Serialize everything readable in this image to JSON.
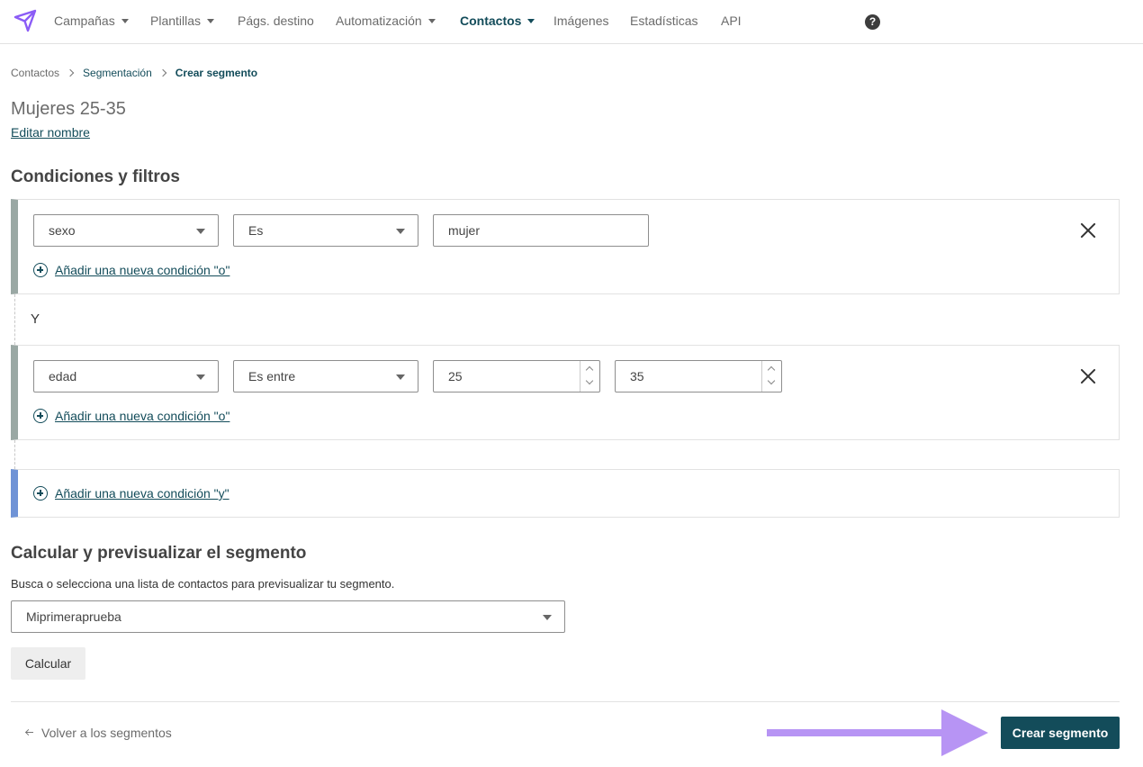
{
  "nav": {
    "items": [
      {
        "label": "Campañas",
        "dropdown": true
      },
      {
        "label": "Plantillas",
        "dropdown": true
      },
      {
        "label": "Págs. destino",
        "dropdown": false
      },
      {
        "label": "Automatización",
        "dropdown": true
      },
      {
        "label": "Contactos",
        "dropdown": true,
        "active": true
      },
      {
        "label": "Imágenes",
        "dropdown": false
      },
      {
        "label": "Estadísticas",
        "dropdown": false
      },
      {
        "label": "API",
        "dropdown": false
      }
    ],
    "help_glyph": "?"
  },
  "breadcrumb": [
    "Contactos",
    "Segmentación",
    "Crear segmento"
  ],
  "segment": {
    "name": "Mujeres 25-35",
    "edit_label": "Editar nombre"
  },
  "conditions": {
    "title": "Condiciones y filtros",
    "and_label": "Y",
    "groups": [
      {
        "field": "sexo",
        "operator": "Es",
        "values": [
          "mujer"
        ],
        "add_or_label": "Añadir una nueva condición \"o\""
      },
      {
        "field": "edad",
        "operator": "Es entre",
        "values": [
          "25",
          "35"
        ],
        "add_or_label": "Añadir una nueva condición \"o\""
      }
    ],
    "add_and_label": "Añadir una nueva condición \"y\""
  },
  "preview": {
    "title": "Calcular y previsualizar el segmento",
    "description": "Busca o selecciona una lista de contactos para previsualizar tu segmento.",
    "list_selected": "Miprimeraprueba",
    "calculate_label": "Calcular"
  },
  "footer": {
    "back_label": "Volver a los segmentos",
    "create_label": "Crear segmento"
  },
  "colors": {
    "brand": "#134c5a",
    "logo": "#8b5cf6",
    "annotation_arrow": "#b794f4",
    "condition_bar": "#9aa8a4",
    "add_bar": "#6f93d6"
  }
}
